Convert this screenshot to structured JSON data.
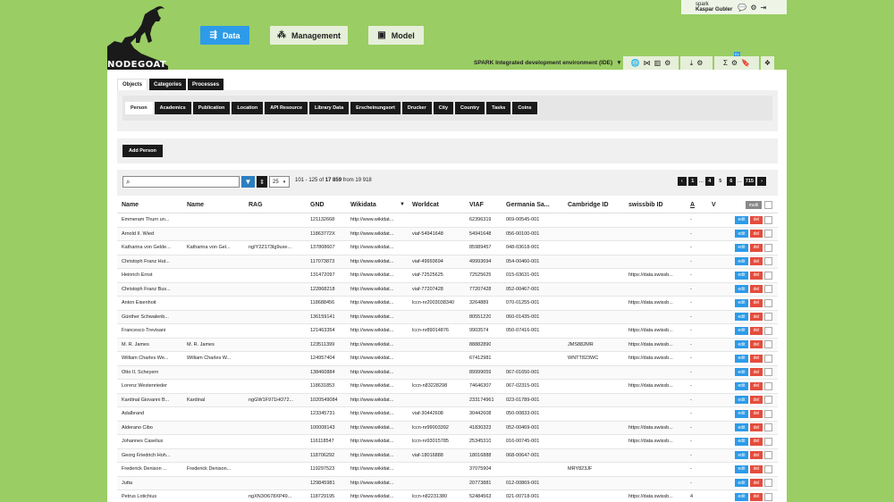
{
  "logo": {
    "text": "NODEGOAT"
  },
  "nav": [
    {
      "label": "Data",
      "icon": "data-flow-icon",
      "active": true
    },
    {
      "label": "Management",
      "icon": "cluster-icon",
      "active": false
    },
    {
      "label": "Model",
      "icon": "model-icon",
      "active": false
    }
  ],
  "user": {
    "project": "spark",
    "name": "Kaspar Gubler"
  },
  "ide": {
    "label": "SPARK Integrated development environment (IDE)"
  },
  "toolbar_badge": "Ex",
  "object_tabs": [
    "Objects",
    "Categories",
    "Processes"
  ],
  "types": [
    "Person",
    "Academics",
    "Publication",
    "Location",
    "API Resource",
    "Library Data",
    "Erscheinungsort",
    "Drucker",
    "City",
    "Country",
    "Tasks",
    "Coins"
  ],
  "add_button": "Add Person",
  "filter": {
    "page_size": "25",
    "range_prefix": "101 - 125 of",
    "range_total": "17 859",
    "range_suffix": "from 19 918"
  },
  "pager": {
    "first": "1",
    "dots1": "...",
    "p4": "4",
    "p5": "5",
    "p6": "6",
    "dots2": "...",
    "last": "715"
  },
  "columns": [
    "Name",
    "Name",
    "RAG",
    "GND",
    "Wikidata",
    "Worldcat",
    "VIAF",
    "Germania Sa...",
    "Cambridge ID",
    "swissbib ID",
    "A",
    "V"
  ],
  "multi_label": "multi",
  "edit_label": "edit",
  "del_label": "del",
  "rows": [
    [
      "Emmeram Thurn un...",
      "",
      "",
      "121132668",
      "http://www.wikidat...",
      "",
      "62396319",
      "069-00545-001",
      "",
      "",
      "-",
      ""
    ],
    [
      "Arnold II. Wied",
      "",
      "",
      "11863772X",
      "http://www.wikidat...",
      "viaf-54941648",
      "54941648",
      "056-00100-001",
      "",
      "",
      "-",
      ""
    ],
    [
      "Katharina von Gelde...",
      "Katharina von Gel...",
      "ngIY2Z173Ig9uxe...",
      "137808607",
      "http://www.wikidat...",
      "",
      "85989457",
      "048-03618-001",
      "",
      "",
      "-",
      ""
    ],
    [
      "Christoph Franz Hut...",
      "",
      "",
      "117073873",
      "http://www.wikidat...",
      "viaf-49993694",
      "49993694",
      "054-00460-001",
      "",
      "",
      "-",
      ""
    ],
    [
      "Heinrich Ernst",
      "",
      "",
      "131472097",
      "http://www.wikidat...",
      "viaf-72525625",
      "72525625",
      "015-03631-001",
      "",
      "https://data.swissb...",
      "-",
      ""
    ],
    [
      "Christoph Franz Bus...",
      "",
      "",
      "122868218",
      "http://www.wikidat...",
      "viaf-77207428",
      "77207428",
      "052-00467-001",
      "",
      "",
      "-",
      ""
    ],
    [
      "Anton Eisenhoit",
      "",
      "",
      "118688456",
      "http://www.wikidat...",
      "lccn-nr2003038340",
      "3264889",
      "070-01255-001",
      "",
      "https://data.swissb...",
      "-",
      ""
    ],
    [
      "Günther Schwalenb...",
      "",
      "",
      "136159141",
      "http://www.wikidat...",
      "",
      "80551220",
      "060-01435-001",
      "",
      "",
      "-",
      ""
    ],
    [
      "Francesco Trevisani",
      "",
      "",
      "121463354",
      "http://www.wikidat...",
      "lccn-nr89014876",
      "9903574",
      "050-07416-001",
      "",
      "https://data.swissb...",
      "-",
      ""
    ],
    [
      "M. R. James",
      "M. R. James",
      "",
      "123511399",
      "http://www.wikidat...",
      "",
      "88882890",
      "",
      "JMS882MR",
      "https://data.swissb...",
      "-",
      ""
    ],
    [
      "William Charles We...",
      "William Charles W...",
      "",
      "124957404",
      "http://www.wikidat...",
      "",
      "67412981",
      "",
      "WNTT823WC",
      "https://data.swissb...",
      "-",
      ""
    ],
    [
      "Otto II. Scheyern",
      "",
      "",
      "138460884",
      "http://www.wikidat...",
      "",
      "89999059",
      "067-01650-001",
      "",
      "",
      "-",
      ""
    ],
    [
      "Lorenz Westenrieder",
      "",
      "",
      "118631853",
      "http://www.wikidat...",
      "lccn-n83228298",
      "74646307",
      "067-02315-001",
      "",
      "https://data.swissb...",
      "-",
      ""
    ],
    [
      "Kardinal Giovanni B...",
      "Kardinal",
      "ngGW1F971HO72...",
      "1020549084",
      "http://www.wikidat...",
      "",
      "233174961",
      "023-01789-001",
      "",
      "",
      "-",
      ""
    ],
    [
      "Adalbrand",
      "",
      "",
      "123345731",
      "http://www.wikidat...",
      "viaf-30442608",
      "30442608",
      "050-00833-001",
      "",
      "",
      "-",
      ""
    ],
    [
      "Alderano Cibo",
      "",
      "",
      "100008143",
      "http://www.wikidat...",
      "lccn-nr99003392",
      "41830323",
      "052-00469-001",
      "",
      "https://data.swissb...",
      "-",
      ""
    ],
    [
      "Johannes Caselius",
      "",
      "",
      "116118547",
      "http://www.wikidat...",
      "lccn-nr93015785",
      "25345310",
      "016-00745-001",
      "",
      "https://data.swissb...",
      "-",
      ""
    ],
    [
      "Georg Friedrich Hoh...",
      "",
      "",
      "118706292",
      "http://www.wikidat...",
      "viaf-18016888",
      "18016888",
      "068-00647-001",
      "",
      "",
      "-",
      ""
    ],
    [
      "Frederick Denison ...",
      "Frederick Denison...",
      "",
      "119297523",
      "http://www.wikidat...",
      "",
      "37075904",
      "",
      "MRY823JF",
      "",
      "-",
      ""
    ],
    [
      "Jutta",
      "",
      "",
      "129845981",
      "http://www.wikidat...",
      "",
      "20773881",
      "012-00869-001",
      "",
      "",
      "-",
      ""
    ],
    [
      "Petrus Lotichius",
      "",
      "ngXN3O678XP49...",
      "118729195",
      "http://www.wikidat...",
      "lccn-n82231380",
      "52484563",
      "021-00718-001",
      "",
      "https://data.swissb...",
      "4",
      ""
    ]
  ]
}
